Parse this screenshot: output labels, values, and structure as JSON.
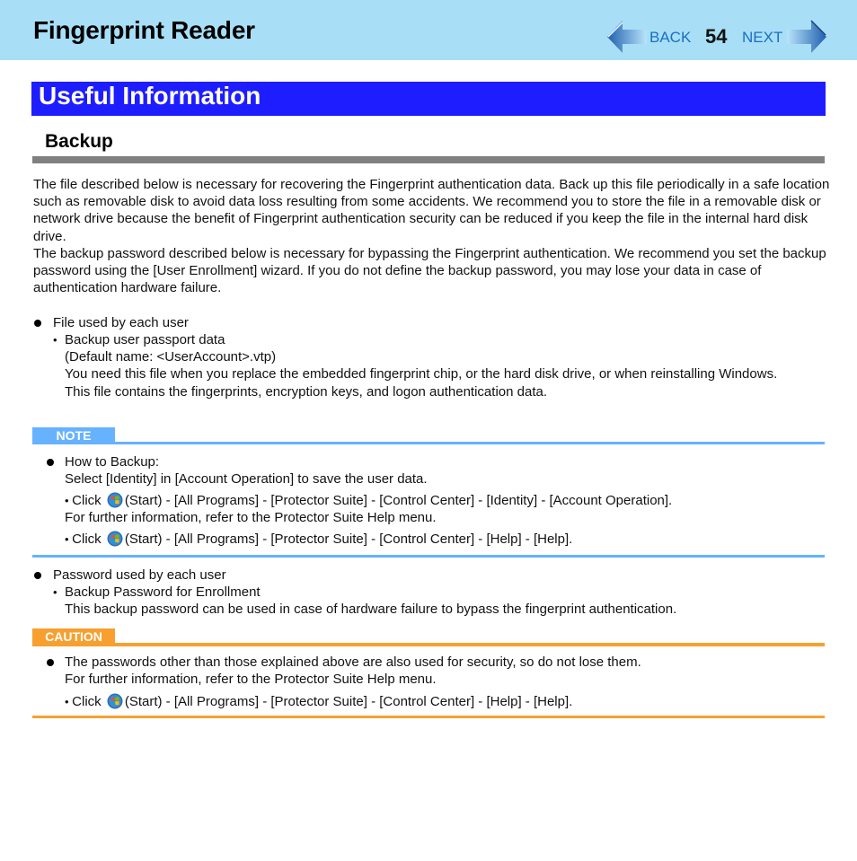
{
  "header": {
    "title": "Fingerprint Reader",
    "nav": {
      "back_icon": "left-arrow-icon",
      "back_label": "BACK",
      "page_number": "54",
      "next_label": "NEXT",
      "next_icon": "right-arrow-icon"
    }
  },
  "section": {
    "title": "Useful Information",
    "subtitle": "Backup"
  },
  "intro": {
    "paragraph1": "The file described below is necessary for recovering the Fingerprint authentication data. Back up this file periodically in a safe location such as removable disk to avoid data loss resulting from some accidents. We recommend you to store the file in a removable disk or network drive because the benefit of Fingerprint authentication security can be reduced if you keep the file in the internal hard disk drive.",
    "paragraph2": "The backup password described below is necessary for bypassing the Fingerprint authentication. We recommend you set the backup password using the [User Enrollment] wizard. If you do not define the backup password, you may lose your data in case of authentication hardware failure."
  },
  "file_section": {
    "bullet": "File used by each user",
    "sub_bullet": "Backup user passport data",
    "lines": [
      "(Default name: <UserAccount>.vtp)",
      "You need this file when you replace the embedded fingerprint chip, or the hard disk drive, or when reinstalling Windows.",
      "This file contains the fingerprints, encryption keys, and logon authentication data."
    ]
  },
  "note": {
    "label": "NOTE",
    "color": "#66b2ff",
    "bullet": "How to Backup:",
    "line": "Select [Identity] in [Account Operation] to save the user data.",
    "step1_prefix": "Click",
    "step1_icon": "windows-start-icon",
    "step1_suffix": "(Start) - [All Programs] - [Protector Suite] - [Control Center] - [Identity] - [Account Operation].",
    "further": "For further information, refer to the Protector Suite Help menu.",
    "step2_prefix": "Click",
    "step2_icon": "windows-start-icon",
    "step2_suffix": "(Start) - [All Programs] - [Protector Suite] - [Control Center] - [Help] - [Help]."
  },
  "password_section": {
    "bullet": "Password used by each user",
    "sub_bullet": "Backup Password for Enrollment",
    "line": "This backup password can be used in case of hardware failure to bypass the fingerprint authentication."
  },
  "caution": {
    "label": "CAUTION",
    "color": "#f7a030",
    "bullet": "The passwords other than those explained above are also used for security, so do not lose them.",
    "further": "For further information, refer to the Protector Suite Help menu.",
    "step_prefix": "Click",
    "step_icon": "windows-start-icon",
    "step_suffix": "(Start) - [All Programs] - [Protector Suite] - [Control Center] - [Help] - [Help]."
  },
  "colors": {
    "header_bg": "#a8dff7",
    "banner_bg": "#1d1dff",
    "rule_gray": "#808080",
    "nav_text": "#1b6ec2"
  }
}
